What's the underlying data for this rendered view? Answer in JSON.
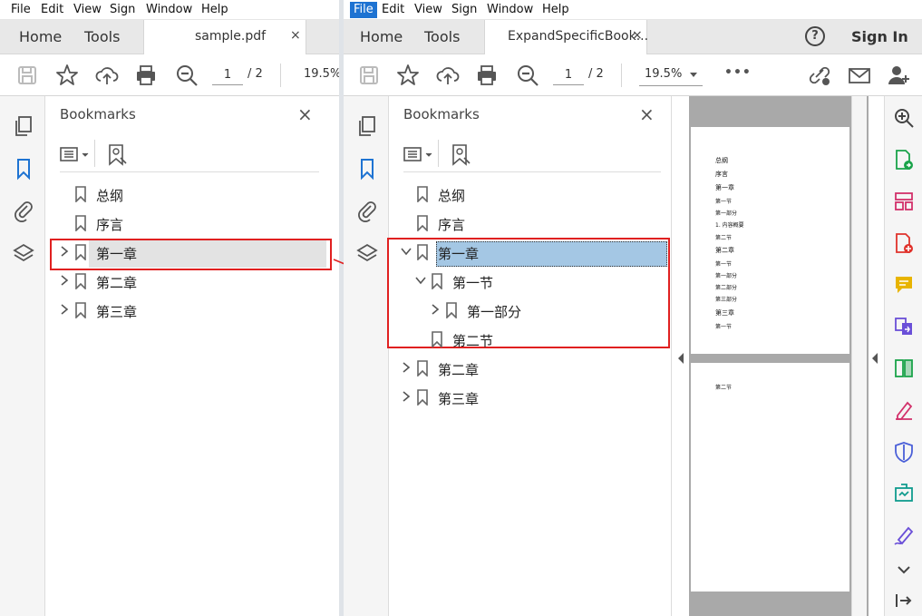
{
  "left_window": {
    "menu": [
      "File",
      "Edit",
      "View",
      "Sign",
      "Window",
      "Help"
    ],
    "tabs": {
      "home": "Home",
      "tools": "Tools"
    },
    "doc_tab": {
      "label": "sample.pdf",
      "close": "×"
    },
    "toolbar": {
      "page_current": "1",
      "page_total": "/ 2",
      "zoom": "19.5%"
    },
    "panel": {
      "title": "Bookmarks",
      "close": "×"
    },
    "bookmarks": [
      {
        "label": "总纲"
      },
      {
        "label": "序言"
      },
      {
        "label": "第一章"
      },
      {
        "label": "第二章"
      },
      {
        "label": "第三章"
      }
    ]
  },
  "right_window": {
    "menu": [
      "File",
      "Edit",
      "View",
      "Sign",
      "Window",
      "Help"
    ],
    "tabs": {
      "home": "Home",
      "tools": "Tools"
    },
    "doc_tab": {
      "label": "ExpandSpecificBook...",
      "close": "×"
    },
    "help_icon": "?",
    "sign_in": "Sign In",
    "toolbar": {
      "page_current": "1",
      "page_total": "/ 2",
      "zoom": "19.5%",
      "more": "•••"
    },
    "panel": {
      "title": "Bookmarks",
      "close": "×"
    },
    "bookmarks": [
      {
        "label": "总纲"
      },
      {
        "label": "序言"
      },
      {
        "label": "第一章"
      },
      {
        "label": "第一节"
      },
      {
        "label": "第一部分"
      },
      {
        "label": "第二节"
      },
      {
        "label": "第二章"
      },
      {
        "label": "第三章"
      }
    ],
    "page1_lines": [
      "总纲",
      "序言",
      "第一章",
      "第一节",
      "第一部分",
      "1. 内容概要",
      "第二节",
      "第二章",
      "第一节",
      "第一部分",
      "第二部分",
      "第三部分",
      "第三章",
      "第一节"
    ],
    "page2_lines": [
      "第二节"
    ]
  },
  "colors": {
    "accent": "#1e73d2",
    "highlight": "#e02020",
    "selection": "#a4c7e4"
  }
}
